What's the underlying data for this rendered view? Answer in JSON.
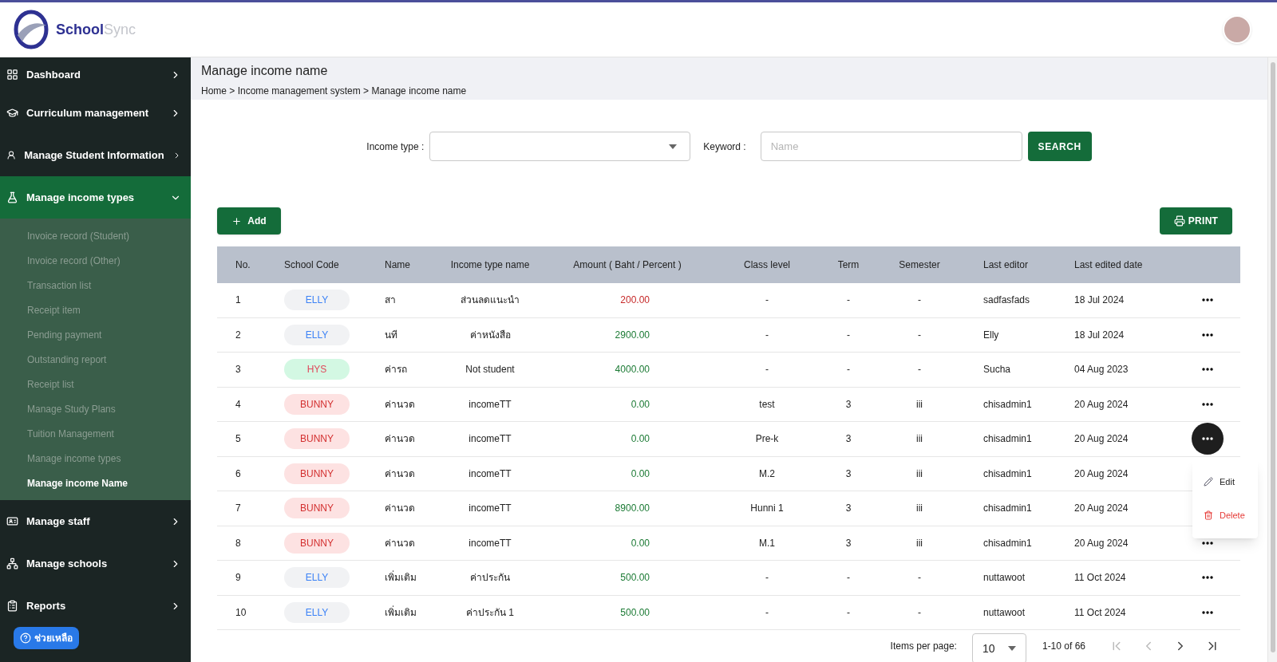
{
  "header": {
    "logo_text": [
      "School",
      "Sync"
    ]
  },
  "sidebar": {
    "items": [
      {
        "label": "Dashboard",
        "expanded": false
      },
      {
        "label": "Curriculum management",
        "expanded": false
      },
      {
        "label": "Manage Student Information",
        "expanded": false
      },
      {
        "label": "Manage income types",
        "expanded": true,
        "children": [
          {
            "label": "Invoice record (Student)",
            "selected": false
          },
          {
            "label": "Invoice record (Other)",
            "selected": false
          },
          {
            "label": "Transaction list",
            "selected": false
          },
          {
            "label": "Receipt item",
            "selected": false
          },
          {
            "label": "Pending payment",
            "selected": false
          },
          {
            "label": "Outstanding report",
            "selected": false
          },
          {
            "label": "Receipt list",
            "selected": false
          },
          {
            "label": "Manage Study Plans",
            "selected": false
          },
          {
            "label": "Tuition Management",
            "selected": false
          },
          {
            "label": "Manage income types",
            "selected": false
          },
          {
            "label": "Manage income Name",
            "selected": true
          }
        ]
      },
      {
        "label": "Manage staff",
        "expanded": false
      },
      {
        "label": "Manage schools",
        "expanded": false
      },
      {
        "label": "Reports",
        "expanded": false
      }
    ],
    "help_button": "ช่วยเหลือ"
  },
  "page": {
    "title": "Manage income name",
    "breadcrumb": "Home > Income management system > Manage income name"
  },
  "filters": {
    "income_type_label": "Income type :",
    "keyword_label": "Keyword :",
    "keyword_placeholder": "Name",
    "search_button": "SEARCH"
  },
  "add_button": "Add",
  "print_button": "PRINT",
  "table": {
    "columns": [
      "No.",
      "School Code",
      "Name",
      "Income type name",
      "Amount ( Baht / Percent )",
      "Class level",
      "Term",
      "Semester",
      "Last editor",
      "Last edited date"
    ],
    "rows": [
      {
        "no": "1",
        "school_code": {
          "label": "ELLY",
          "kind": "plain",
          "color": "#3b82f6"
        },
        "name": "สา",
        "income_type": "ส่วนลดแนะนำ",
        "amount": {
          "text": "200.00",
          "color": "#c62828"
        },
        "class_level": "-",
        "term": "-",
        "semester": "-",
        "last_editor": "sadfasfads",
        "date": "18 Jul 2024",
        "menu_open": false
      },
      {
        "no": "2",
        "school_code": {
          "label": "ELLY",
          "kind": "plain",
          "color": "#3b82f6"
        },
        "name": "นที",
        "income_type": "ค่าหนังสือ",
        "amount": {
          "text": "2900.00",
          "color": "#1b7a34"
        },
        "class_level": "-",
        "term": "-",
        "semester": "-",
        "last_editor": "Elly",
        "date": "18 Jul 2024",
        "menu_open": false
      },
      {
        "no": "3",
        "school_code": {
          "label": "HYS",
          "kind": "mint",
          "color": "#e0475a"
        },
        "name": "ค่ารถ",
        "income_type": "Not student",
        "amount": {
          "text": "4000.00",
          "color": "#1b7a34"
        },
        "class_level": "-",
        "term": "-",
        "semester": "-",
        "last_editor": "Sucha",
        "date": "04 Aug 2023",
        "menu_open": false
      },
      {
        "no": "4",
        "school_code": {
          "label": "BUNNY",
          "kind": "rose",
          "color": "#d32f2f"
        },
        "name": "ค่านวด",
        "income_type": "incomeTT",
        "amount": {
          "text": "0.00",
          "color": "#1b7a34"
        },
        "class_level": "test",
        "term": "3",
        "semester": "iii",
        "last_editor": "chisadmin1",
        "date": "20 Aug 2024",
        "menu_open": false
      },
      {
        "no": "5",
        "school_code": {
          "label": "BUNNY",
          "kind": "rose",
          "color": "#d32f2f"
        },
        "name": "ค่านวด",
        "income_type": "incomeTT",
        "amount": {
          "text": "0.00",
          "color": "#1b7a34"
        },
        "class_level": "Pre-k",
        "term": "3",
        "semester": "iii",
        "last_editor": "chisadmin1",
        "date": "20 Aug 2024",
        "menu_open": true
      },
      {
        "no": "6",
        "school_code": {
          "label": "BUNNY",
          "kind": "rose",
          "color": "#d32f2f"
        },
        "name": "ค่านวด",
        "income_type": "incomeTT",
        "amount": {
          "text": "0.00",
          "color": "#1b7a34"
        },
        "class_level": "M.2",
        "term": "3",
        "semester": "iii",
        "last_editor": "chisadmin1",
        "date": "20 Aug 2024"
      },
      {
        "no": "7",
        "school_code": {
          "label": "BUNNY",
          "kind": "rose",
          "color": "#d32f2f"
        },
        "name": "ค่านวด",
        "income_type": "incomeTT",
        "amount": {
          "text": "8900.00",
          "color": "#1b7a34"
        },
        "class_level": "Hunni 1",
        "term": "3",
        "semester": "iii",
        "last_editor": "chisadmin1",
        "date": "20 Aug 2024"
      },
      {
        "no": "8",
        "school_code": {
          "label": "BUNNY",
          "kind": "rose",
          "color": "#d32f2f"
        },
        "name": "ค่านวด",
        "income_type": "incomeTT",
        "amount": {
          "text": "0.00",
          "color": "#1b7a34"
        },
        "class_level": "M.1",
        "term": "3",
        "semester": "iii",
        "last_editor": "chisadmin1",
        "date": "20 Aug 2024",
        "menu_open": false
      },
      {
        "no": "9",
        "school_code": {
          "label": "ELLY",
          "kind": "plain",
          "color": "#3b82f6"
        },
        "name": "เพิ่มเติม",
        "income_type": "ค่าประกัน",
        "amount": {
          "text": "500.00",
          "color": "#1b7a34"
        },
        "class_level": "-",
        "term": "-",
        "semester": "-",
        "last_editor": "nuttawoot",
        "date": "11 Oct 2024",
        "menu_open": false
      },
      {
        "no": "10",
        "school_code": {
          "label": "ELLY",
          "kind": "plain",
          "color": "#3b82f6"
        },
        "name": "เพิ่มเติม",
        "income_type": "ค่าประกัน 1",
        "amount": {
          "text": "500.00",
          "color": "#1b7a34"
        },
        "class_level": "-",
        "term": "-",
        "semester": "-",
        "last_editor": "nuttawoot",
        "date": "11 Oct 2024",
        "menu_open": false
      }
    ]
  },
  "row_menu": {
    "items": [
      {
        "label": "Edit",
        "kind": "edit"
      },
      {
        "label": "Delete",
        "kind": "delete"
      }
    ]
  },
  "pagination": {
    "label": "Items per page:",
    "page_size": "10",
    "range": "1-10 of 66"
  }
}
